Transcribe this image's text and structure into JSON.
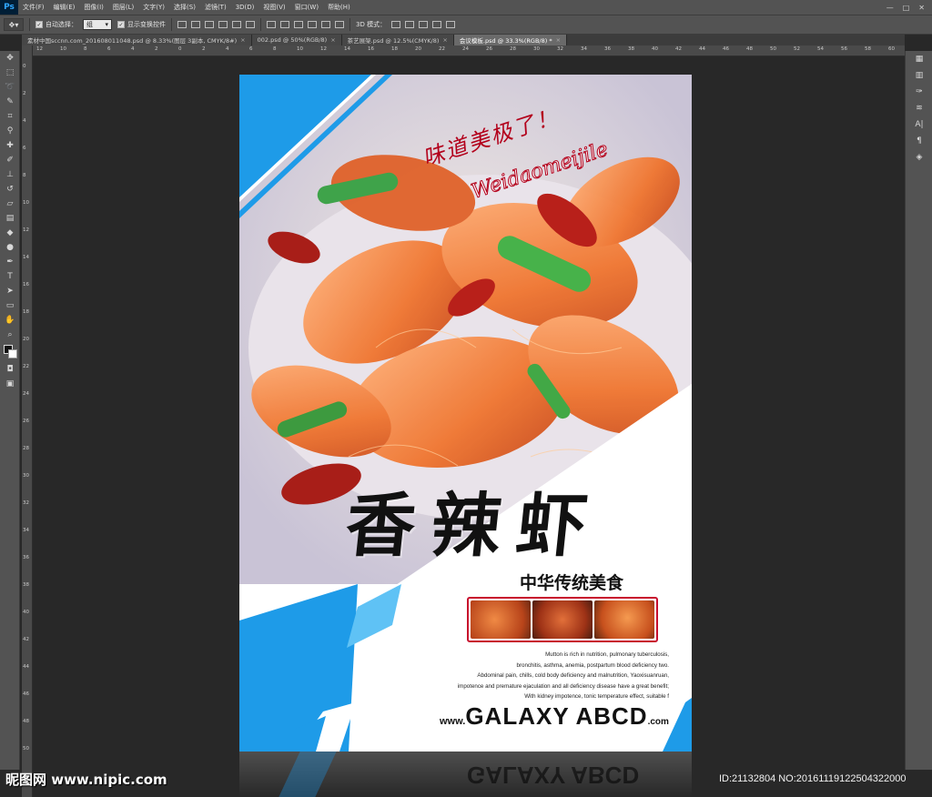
{
  "app": {
    "logo": "Ps"
  },
  "menu": [
    "文件(F)",
    "编辑(E)",
    "图像(I)",
    "图层(L)",
    "文字(Y)",
    "选择(S)",
    "滤镜(T)",
    "3D(D)",
    "视图(V)",
    "窗口(W)",
    "帮助(H)"
  ],
  "window_controls": {
    "minimize": "—",
    "maximize": "□",
    "close": "✕"
  },
  "options": {
    "auto_select_label": "自动选择：",
    "auto_select_value": "组",
    "show_transform_label": "显示变换控件",
    "mode_3d_label": "3D 模式："
  },
  "tabs": [
    {
      "label": "素材中国sccnn.com_20160801104​8.psd @ 8.33%(图层 3副本, CMYK/8#)",
      "active": false
    },
    {
      "label": "002.psd @ 50%(RGB/8)",
      "active": false
    },
    {
      "label": "茶艺展架.psd @ 12.5%(CMYK/8)",
      "active": false
    },
    {
      "label": "会议模板.psd @ 33.3%(RGB/8) *",
      "active": true
    }
  ],
  "ruler_top_labels": [
    "12",
    "10",
    "8",
    "6",
    "4",
    "2",
    "0",
    "2",
    "4",
    "6",
    "8",
    "10",
    "12",
    "14",
    "16",
    "18",
    "20",
    "22",
    "24",
    "26",
    "28",
    "30",
    "32",
    "34",
    "36",
    "38",
    "40",
    "42",
    "44",
    "46",
    "48",
    "50",
    "52",
    "54",
    "56",
    "58",
    "60"
  ],
  "ruler_left_labels": [
    "0",
    "2",
    "4",
    "6",
    "8",
    "10",
    "12",
    "14",
    "16",
    "18",
    "20",
    "22",
    "24",
    "26",
    "28",
    "30",
    "32",
    "34",
    "36",
    "38",
    "40",
    "42",
    "44",
    "46",
    "48",
    "50"
  ],
  "poster": {
    "brush_title": "味道美极了！",
    "brush_subtitle": "Weidaomeijile",
    "title": "香辣虾",
    "subtitle": "中华传统美食",
    "description": [
      "Mutton is rich in nutrition, pulmonary tuberculosis,",
      "bronchitis, asthma, anemia, postpartum blood deficiency two.",
      "Abdominal pain, chills, cold body deficiency and malnutrition, Yaoxisuanruan,",
      "impotence and premature ejaculation and all deficiency disease have a great benefit;",
      "With kidney impotence, tonic temperature effect, suitable f"
    ],
    "url_prefix": "www.",
    "url_main": "GALAXY ABCD",
    "url_suffix": ".com"
  },
  "watermark": {
    "site": "昵图网 www.nipic.com",
    "id_text": "ID:21132804 NO:20161119122504322000"
  },
  "colors": {
    "accent_blue": "#1e9be8",
    "brand_red": "#b3001b",
    "ps_blue": "#31a8ff"
  }
}
